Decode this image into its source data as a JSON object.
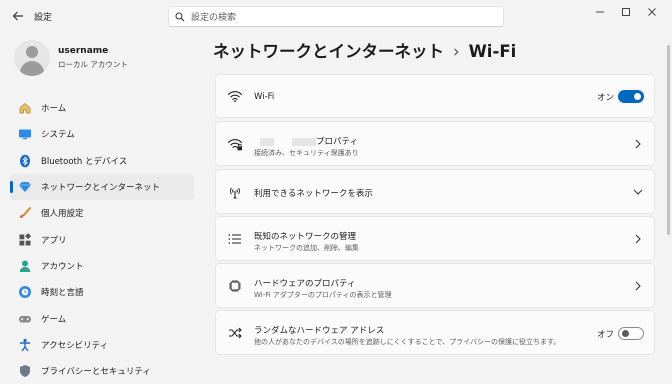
{
  "window": {
    "title": "設定",
    "search_placeholder": "設定の検索"
  },
  "profile": {
    "username": "username",
    "account_type": "ローカル アカウント"
  },
  "nav": [
    {
      "label": "ホーム",
      "icon": "home-icon"
    },
    {
      "label": "システム",
      "icon": "system-display-icon"
    },
    {
      "label": "Bluetooth とデバイス",
      "icon": "bluetooth-icon"
    },
    {
      "label": "ネットワークとインターネット",
      "icon": "network-diamond-icon",
      "active": true
    },
    {
      "label": "個人用設定",
      "icon": "paintbrush-icon"
    },
    {
      "label": "アプリ",
      "icon": "apps-icon"
    },
    {
      "label": "アカウント",
      "icon": "account-icon"
    },
    {
      "label": "時刻と言語",
      "icon": "globe-clock-icon"
    },
    {
      "label": "ゲーム",
      "icon": "gamepad-icon"
    },
    {
      "label": "アクセシビリティ",
      "icon": "accessibility-icon"
    },
    {
      "label": "プライバシーとセキュリティ",
      "icon": "shield-icon"
    }
  ],
  "breadcrumb": {
    "parent": "ネットワークとインターネット",
    "separator": "›",
    "current": "Wi-Fi"
  },
  "cards": {
    "wifi": {
      "title": "Wi-Fi",
      "toggle_label": "オン",
      "toggle_on": true
    },
    "properties": {
      "title_suffix": "プロパティ",
      "subtitle": "接続済み、セキュリティ保護あり"
    },
    "available": {
      "title": "利用できるネットワークを表示"
    },
    "known": {
      "title": "既知のネットワークの管理",
      "subtitle": "ネットワークの追加、削除、編集"
    },
    "hardware": {
      "title": "ハードウェアのプロパティ",
      "subtitle": "Wi-Fi アダプターのプロパティの表示と管理"
    },
    "random": {
      "title": "ランダムなハードウェア アドレス",
      "subtitle": "他の人があなたのデバイスの場所を追跡しにくくすることで、プライバシーの保護に役立ちます。",
      "toggle_label": "オフ",
      "toggle_on": false
    }
  },
  "colors": {
    "accent": "#0067c0",
    "background": "#f3f3f3",
    "card": "#fbfbfb"
  }
}
